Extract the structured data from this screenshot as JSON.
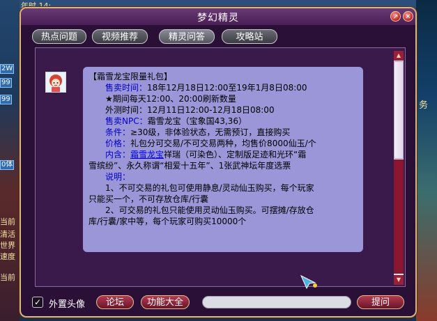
{
  "background": {
    "top_text": "年时  14:",
    "left_chips": [
      "2W",
      "99",
      "99",
      "0体"
    ],
    "left_labels": [
      "当前",
      "清活",
      "世界",
      "速度",
      "当前"
    ],
    "right_label": "务"
  },
  "window": {
    "title": "梦幻精灵",
    "title_buttons": [
      "↗",
      "✕"
    ]
  },
  "tabs": [
    {
      "label": "热点问题",
      "active": false
    },
    {
      "label": "视频推荐",
      "active": false
    },
    {
      "label": "精灵问答",
      "active": true
    },
    {
      "label": "攻略站",
      "active": false
    }
  ],
  "message": {
    "heading": "【霜雪龙宝限量礼包】",
    "sale_time_label": "售卖时间：",
    "sale_time_value": "18年12月18日12:00至19年1月8日08:00",
    "refresh_note": "★期间每天12:00、20:00刷新数量",
    "test_time": "外测时间：12月11日12:00-12月18日08:00",
    "npc_label": "售卖NPC：",
    "npc_value": "霜雪龙宝（宝象国43,36）",
    "condition_label": "条件：",
    "condition_value": "≥30级，非体验状态，无需预订，直接购买",
    "price_label": "价格：",
    "price_value": "礼包分可交易/不可交易两种，均售价8000仙玉/个",
    "contents_label": "内含：",
    "contents_link": "霜雪龙宝",
    "contents_value_1": "祥瑞（可染色）、定制版足迹和光环“霜",
    "contents_value_2": "雪缤纷”、永久称谓“相爱十五年”、1张武神坛年度选票",
    "notes_label": "说明：",
    "note_1a": "1、不可交易的礼包可使用静息/灵动仙玉购买，每个玩家",
    "note_1b": "只能买一个，不可存放仓库/行囊",
    "note_2a": "2、可交易的礼包只能使用灵动仙玉购买。可摆摊/存放仓",
    "note_2b": "库/行囊/家中等，每个玩家可购买10000个"
  },
  "footer": {
    "external_avatar_label": "外置头像",
    "external_avatar_checked": true,
    "forum_button": "论坛",
    "features_button": "功能大全",
    "question_input_value": "",
    "ask_button": "提问"
  },
  "colors": {
    "bubble": "#9a96d8",
    "label_blue": "#0000c8",
    "window_bg": "#2a0f36",
    "button_red": "#b23a52"
  }
}
